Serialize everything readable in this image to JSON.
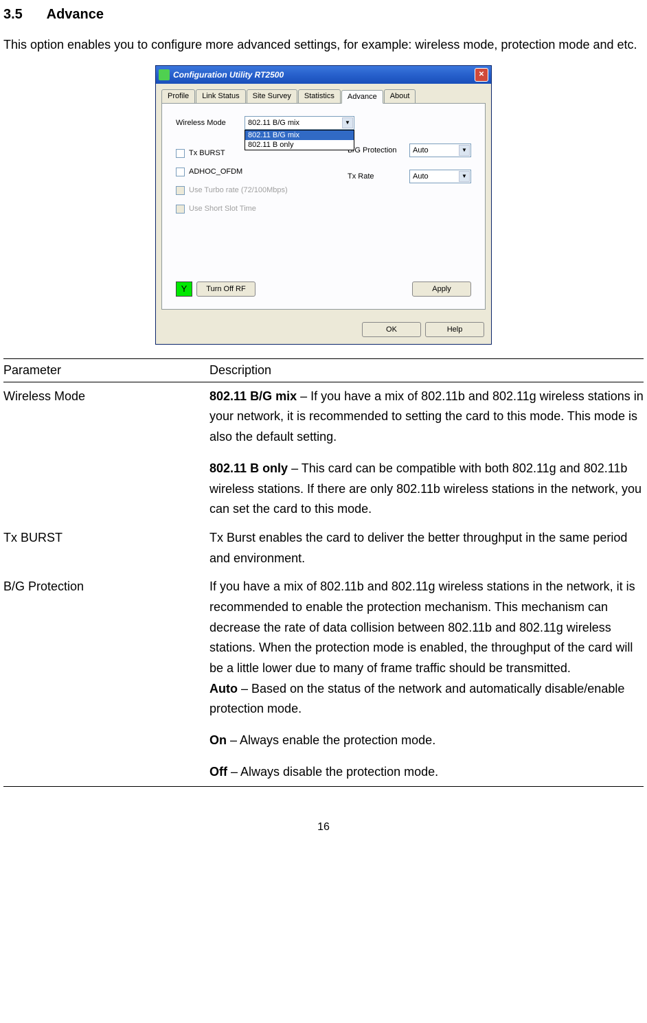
{
  "section": {
    "number": "3.5",
    "title": "Advance"
  },
  "intro": "This option enables you to configure more advanced settings, for example: wireless mode, protection mode and etc.",
  "dialog": {
    "title": "Configuration Utility RT2500",
    "tabs": [
      "Profile",
      "Link Status",
      "Site Survey",
      "Statistics",
      "Advance",
      "About"
    ],
    "active_tab": "Advance",
    "wireless_mode_label": "Wireless Mode",
    "wireless_mode_value": "802.11 B/G mix",
    "dropdown_options": [
      "802.11 B/G mix",
      "802.11 B only"
    ],
    "tx_burst_label": "Tx BURST",
    "adhoc_label": "ADHOC_OFDM",
    "turbo_label": "Use Turbo rate (72/100Mbps)",
    "slot_label": "Use Short Slot Time",
    "bg_protection_label": "B/G Protection",
    "bg_protection_value": "Auto",
    "tx_rate_label": "Tx Rate",
    "tx_rate_value": "Auto",
    "turn_off_rf": "Turn Off RF",
    "apply": "Apply",
    "ok": "OK",
    "help": "Help"
  },
  "table": {
    "header_param": "Parameter",
    "header_desc": "Description",
    "rows": {
      "wireless_mode": {
        "param": "Wireless Mode",
        "p1_bold": "802.11 B/G mix",
        "p1_rest": " – If you have a mix of 802.11b and 802.11g wireless stations in your network, it is recommended to setting the card to this mode. This mode is also the default setting.",
        "p2_bold": "802.11 B only",
        "p2_rest": " – This card can be compatible with both 802.11g and 802.11b wireless stations. If there are only 802.11b wireless stations in the network, you can set the card to this mode."
      },
      "tx_burst": {
        "param": "Tx BURST",
        "desc": "Tx Burst enables the card to deliver the better throughput in the same period and environment."
      },
      "bg_protection": {
        "param": "B/G Protection",
        "p1": "If you have a mix of 802.11b and 802.11g wireless stations in the network, it is recommended to enable the protection mechanism. This mechanism can decrease the rate of data collision between 802.11b and 802.11g wireless stations. When the protection mode is enabled, the throughput of the card will be a little lower due to many of frame traffic should be transmitted.",
        "auto_bold": "Auto",
        "auto_rest": " – Based on the status of the network and automatically disable/enable protection mode.",
        "on_bold": "On",
        "on_rest": " – Always enable the protection mode.",
        "off_bold": "Off",
        "off_rest": " – Always disable the protection mode."
      }
    }
  },
  "page_number": "16"
}
